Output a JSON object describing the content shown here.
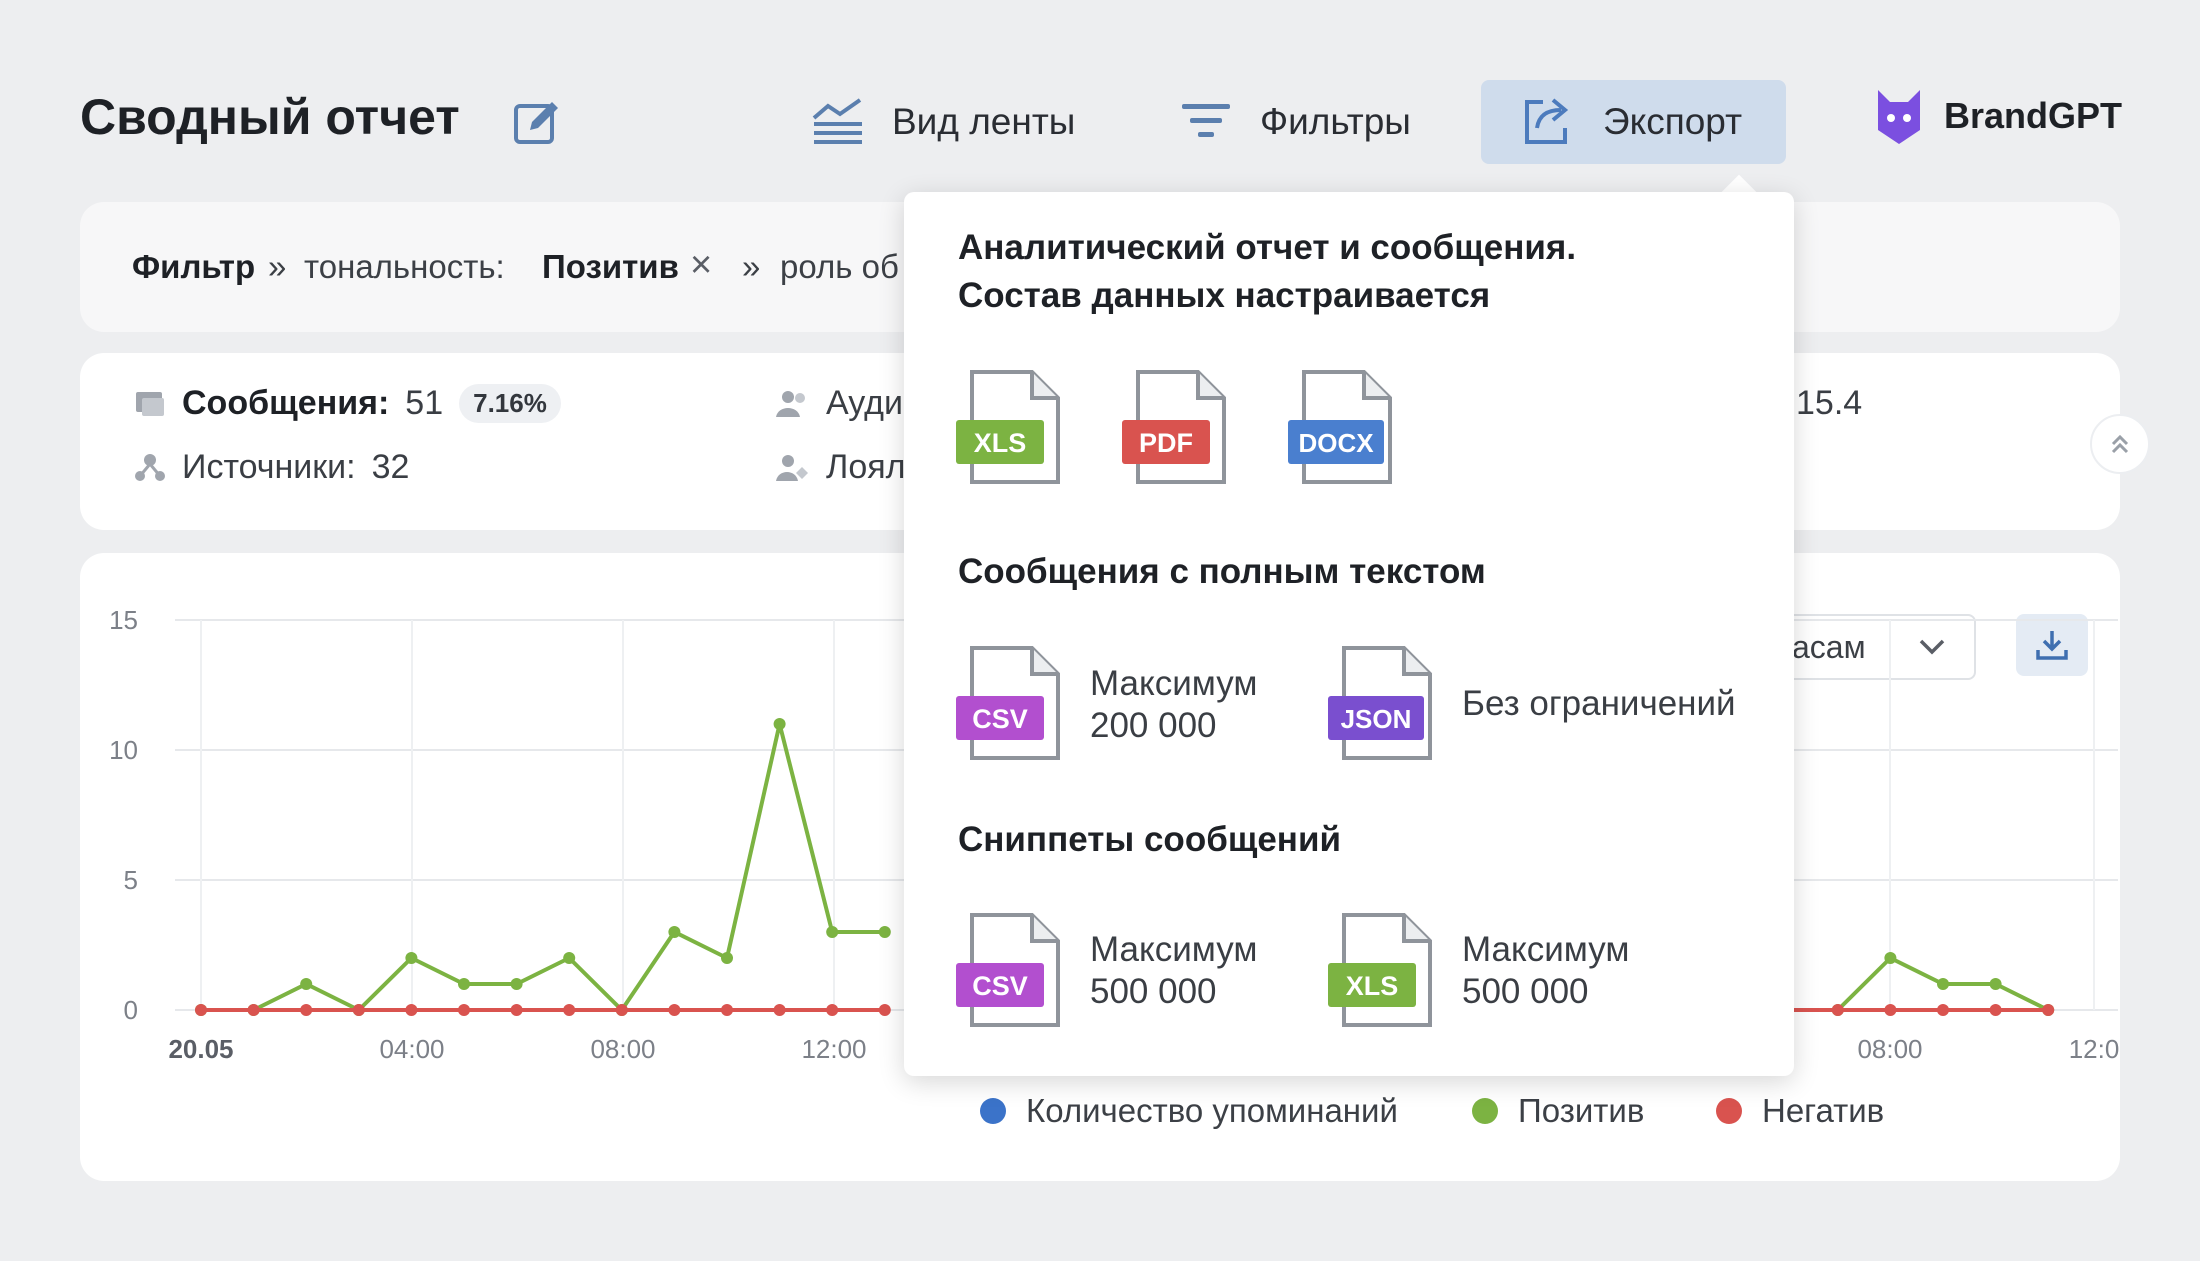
{
  "header": {
    "title": "Сводный отчет",
    "feed_view": "Вид ленты",
    "filters": "Фильтры",
    "export": "Экспорт",
    "brand": "BrandGPT"
  },
  "filter_bar": {
    "label": "Фильтр",
    "sep": "»",
    "key": "тональность:",
    "value": "Позитив",
    "remove": "×",
    "next": "роль об"
  },
  "stats": {
    "messages_label": "Сообщения:",
    "messages_value": "51",
    "messages_pct": "7.16%",
    "sources_label": "Источники:",
    "sources_value": "32",
    "audience_label": "Ауди",
    "loyalty_label": "Лоял",
    "right_value": "15.4"
  },
  "chart_controls": {
    "group_select": "асам"
  },
  "chart_data": {
    "type": "line",
    "ylim": [
      0,
      15
    ],
    "yticks": [
      "15",
      "10",
      "5",
      "0"
    ],
    "xticks": [
      "20.05",
      "04:00",
      "08:00",
      "12:00",
      "08:00",
      "12:0"
    ],
    "series": [
      {
        "name": "Позитив",
        "color": "#7cb342",
        "segment": "left",
        "values": [
          0,
          0,
          1,
          0,
          2,
          1,
          1,
          2,
          0,
          3,
          2,
          11,
          3,
          3
        ]
      },
      {
        "name": "Позитив",
        "color": "#7cb342",
        "segment": "right",
        "values": [
          1,
          0,
          0,
          0,
          2,
          1,
          1,
          0
        ]
      },
      {
        "name": "Негатив",
        "color": "#d9534f",
        "segment": "left",
        "values": [
          0,
          0,
          0,
          0,
          0,
          0,
          0,
          0,
          0,
          0,
          0,
          0,
          0,
          0
        ]
      },
      {
        "name": "Негатив",
        "color": "#d9534f",
        "segment": "right",
        "values": [
          0,
          0,
          0,
          0,
          0,
          0,
          0,
          0
        ]
      }
    ],
    "legend": [
      {
        "label": "Количество упоминаний",
        "color": "#3b73c9"
      },
      {
        "label": "Позитив",
        "color": "#7cb342"
      },
      {
        "label": "Негатив",
        "color": "#d9534f"
      }
    ]
  },
  "export_menu": {
    "section1": [
      "Аналитический отчет и сообщения.",
      "Состав данных настраивается"
    ],
    "formats1": [
      {
        "label": "XLS",
        "color": "#7cb342"
      },
      {
        "label": "PDF",
        "color": "#d9534f"
      },
      {
        "label": "DOCX",
        "color": "#4a7fcf"
      }
    ],
    "section2": "Сообщения с полным текстом",
    "csv_full": {
      "label": "CSV",
      "color": "#b24fcf",
      "line1": "Максимум",
      "line2": "200 000"
    },
    "json_full": {
      "label": "JSON",
      "color": "#7a4fcf",
      "line1": "Без ограничений"
    },
    "section3": "Сниппеты сообщений",
    "csv_snip": {
      "label": "CSV",
      "color": "#b24fcf",
      "line1": "Максимум",
      "line2": "500 000"
    },
    "xls_snip": {
      "label": "XLS",
      "color": "#7cb342",
      "line1": "Максимум",
      "line2": "500 000"
    }
  }
}
